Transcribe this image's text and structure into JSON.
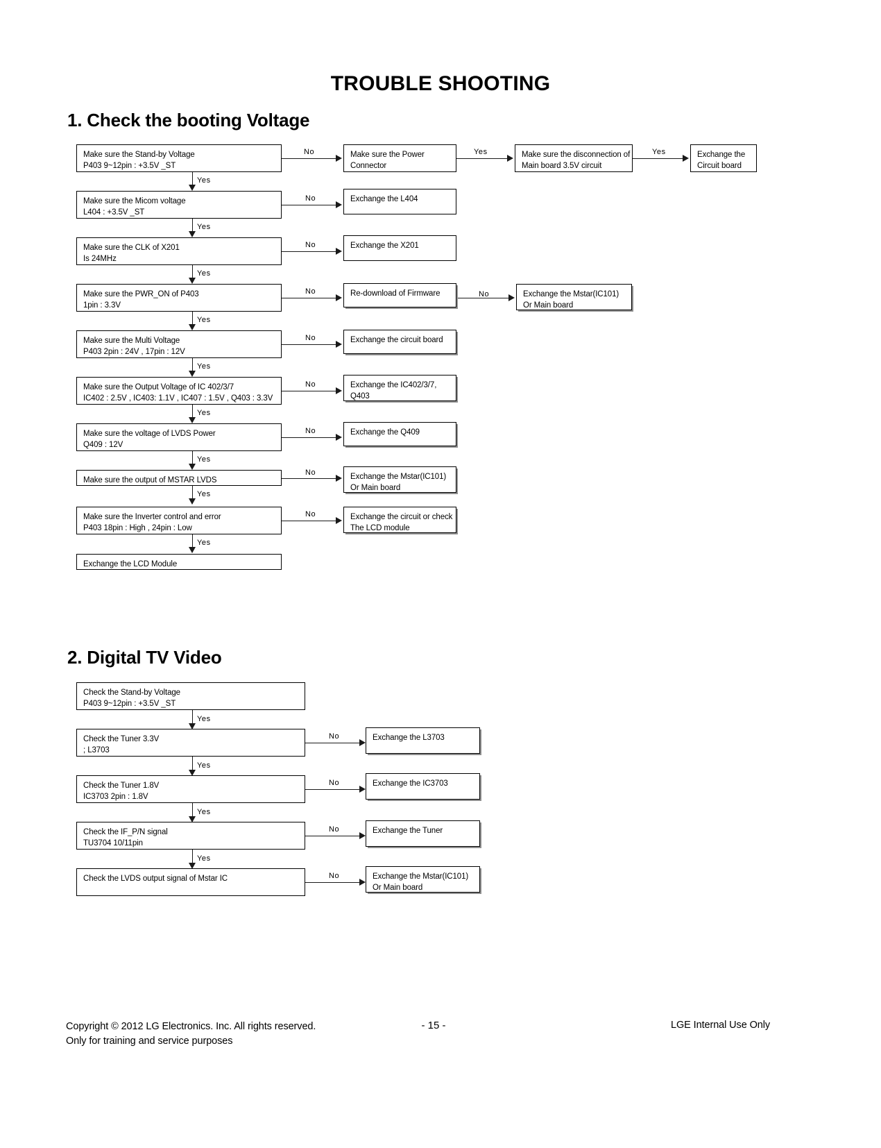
{
  "document": {
    "title": "TROUBLE SHOOTING"
  },
  "sections": [
    {
      "heading": "1. Check the booting Voltage",
      "flow": {
        "rows": [
          {
            "check": {
              "line1": "Make sure the Stand-by Voltage",
              "line2": "P403 9~12pin : +3.5V _ST"
            },
            "branch_label": "No",
            "action": {
              "line1": "Make sure the Power",
              "line2": "Connector"
            },
            "branch2_label": "Yes",
            "action2": {
              "line1": "Make sure the disconnection of",
              "line2": "Main board 3.5V  circuit"
            },
            "branch3_label": "Yes",
            "action3": {
              "line1": "Exchange the",
              "line2": "Circuit board"
            },
            "down_label": "Yes"
          },
          {
            "check": {
              "line1": "Make sure the Micom voltage",
              "line2": "L404 : +3.5V _ST"
            },
            "branch_label": "No",
            "action": {
              "line1": "Exchange the L404",
              "line2": ""
            },
            "down_label": "Yes"
          },
          {
            "check": {
              "line1": "Make sure the CLK of X201",
              "line2": "Is 24MHz"
            },
            "branch_label": "No",
            "action": {
              "line1": "Exchange the X201",
              "line2": ""
            },
            "down_label": "Yes"
          },
          {
            "check": {
              "line1": "Make sure the PWR_ON of P403",
              "line2": "1pin : 3.3V"
            },
            "branch_label": "No",
            "action": {
              "line1": "Re-download of Firmware",
              "line2": ""
            },
            "branch2_label": "No",
            "action2": {
              "line1": "Exchange the Mstar(IC101)",
              "line2": "Or Main board"
            },
            "down_label": "Yes"
          },
          {
            "check": {
              "line1": "Make sure the Multi Voltage",
              "line2": "P403 2pin : 24V , 17pin : 12V"
            },
            "branch_label": "No",
            "action": {
              "line1": "Exchange the circuit board",
              "line2": ""
            },
            "down_label": "Yes"
          },
          {
            "check": {
              "line1": "Make sure the Output Voltage of IC 402/3/7",
              "line2": "IC402 : 2.5V , IC403: 1.1V , IC407 : 1.5V , Q403 : 3.3V"
            },
            "branch_label": "No",
            "action": {
              "line1": "Exchange the IC402/3/7,",
              "line2": "Q403"
            },
            "down_label": "Yes"
          },
          {
            "check": {
              "line1": "Make sure the voltage of LVDS Power",
              "line2": "Q409 : 12V"
            },
            "branch_label": "No",
            "action": {
              "line1": "Exchange the Q409",
              "line2": ""
            },
            "down_label": "Yes"
          },
          {
            "check": {
              "line1": "Make sure the output of MSTAR LVDS",
              "line2": ""
            },
            "branch_label": "No",
            "action": {
              "line1": "Exchange the Mstar(IC101)",
              "line2": "Or Main board"
            },
            "down_label": "Yes"
          },
          {
            "check": {
              "line1": "Make sure the Inverter control and error",
              "line2": "P403 18pin : High , 24pin : Low"
            },
            "branch_label": "No",
            "action": {
              "line1": "Exchange the circuit or check",
              "line2": "The LCD module"
            },
            "down_label": "Yes"
          },
          {
            "check": {
              "line1": "Exchange the LCD Module",
              "line2": ""
            }
          }
        ]
      }
    },
    {
      "heading": "2. Digital TV Video",
      "flow": {
        "rows": [
          {
            "check": {
              "line1": "Check the Stand-by Voltage",
              "line2": "P403 9~12pin : +3.5V _ST"
            },
            "down_label": "Yes"
          },
          {
            "check": {
              "line1": "Check the Tuner 3.3V",
              "line2": "; L3703"
            },
            "branch_label": "No",
            "action": {
              "line1": "Exchange the L3703",
              "line2": ""
            },
            "down_label": "Yes"
          },
          {
            "check": {
              "line1": "Check the Tuner 1.8V",
              "line2": "IC3703 2pin : 1.8V"
            },
            "branch_label": "No",
            "action": {
              "line1": "Exchange the IC3703",
              "line2": ""
            },
            "down_label": "Yes"
          },
          {
            "check": {
              "line1": "Check the IF_P/N signal",
              "line2": "TU3704 10/11pin"
            },
            "branch_label": "No",
            "action": {
              "line1": "Exchange the Tuner",
              "line2": ""
            },
            "down_label": "Yes"
          },
          {
            "check": {
              "line1": "Check the LVDS output signal of Mstar IC",
              "line2": ""
            },
            "branch_label": "No",
            "action": {
              "line1": "Exchange the Mstar(IC101)",
              "line2": "Or Main board"
            }
          }
        ]
      }
    }
  ],
  "footer": {
    "copyright_line1": "Copyright  © 2012  LG Electronics. Inc. All rights reserved.",
    "copyright_line2": "Only for training and service purposes",
    "page_number": "- 15 -",
    "notice": "LGE Internal Use Only"
  }
}
